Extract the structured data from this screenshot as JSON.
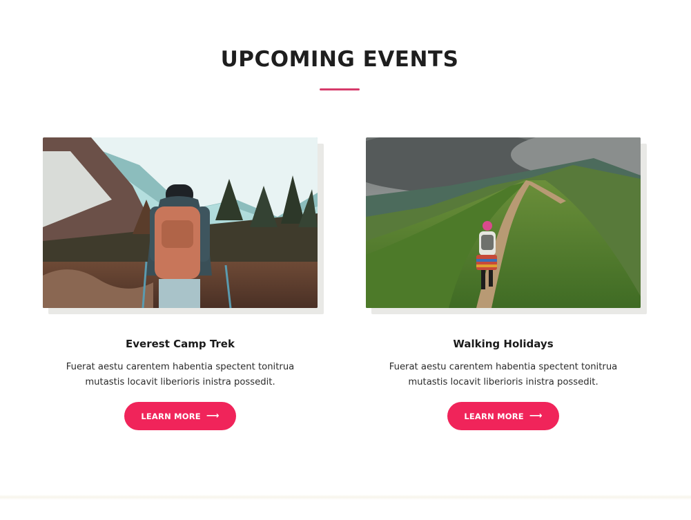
{
  "section": {
    "title": "UPCOMING EVENTS",
    "accent": "#d63a6a"
  },
  "events": [
    {
      "title": "Everest Camp Trek",
      "description": "Fuerat aestu carentem habentia spectent tonitrua mutastis locavit liberioris inistra possedit.",
      "button_label": "LEARN MORE",
      "button_icon": "arrow-right-icon"
    },
    {
      "title": "Walking Holidays",
      "description": "Fuerat aestu carentem habentia spectent tonitrua mutastis locavit liberioris inistra possedit.",
      "button_label": "LEARN MORE",
      "button_icon": "arrow-right-icon"
    }
  ],
  "colors": {
    "button": "#f0245a",
    "text": "#1e1e1e"
  }
}
